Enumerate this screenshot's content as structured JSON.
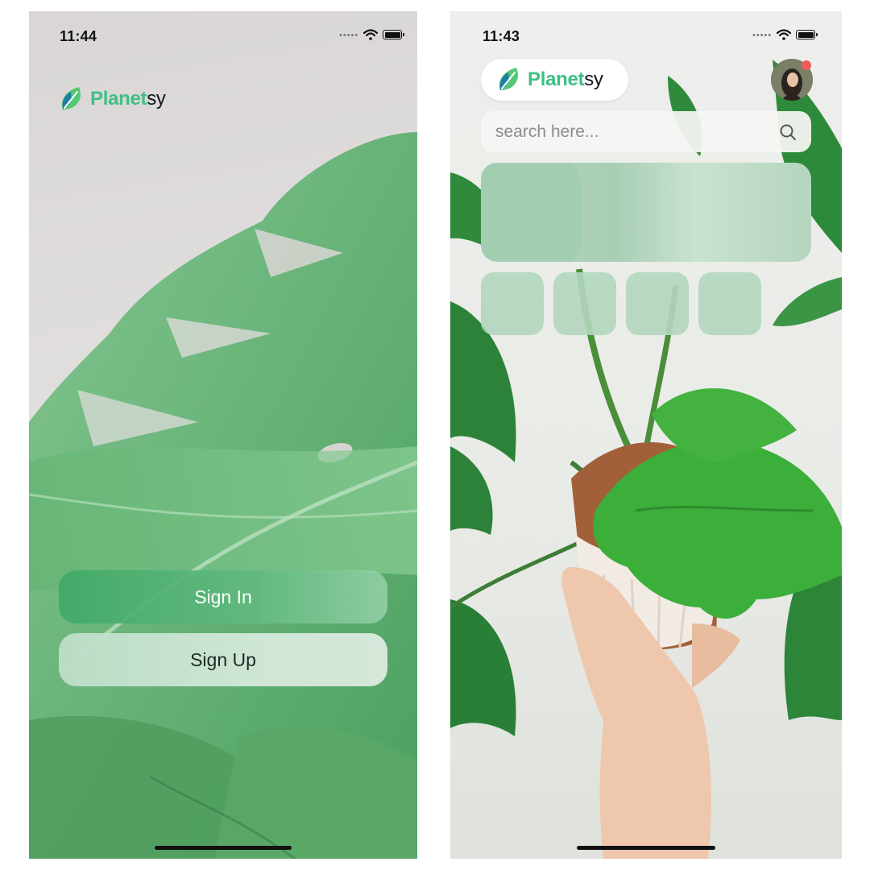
{
  "screen_left": {
    "status": {
      "time": "11:44"
    },
    "logo": {
      "part1": "Planet",
      "part2": "sy"
    },
    "buttons": {
      "sign_in": "Sign In",
      "sign_up": "Sign Up"
    }
  },
  "screen_right": {
    "status": {
      "time": "11:43"
    },
    "logo": {
      "part1": "Planet",
      "part2": "sy"
    },
    "search": {
      "placeholder": "search here..."
    },
    "accent_color": "#3fbf86",
    "notification_color": "#f05a5a"
  }
}
